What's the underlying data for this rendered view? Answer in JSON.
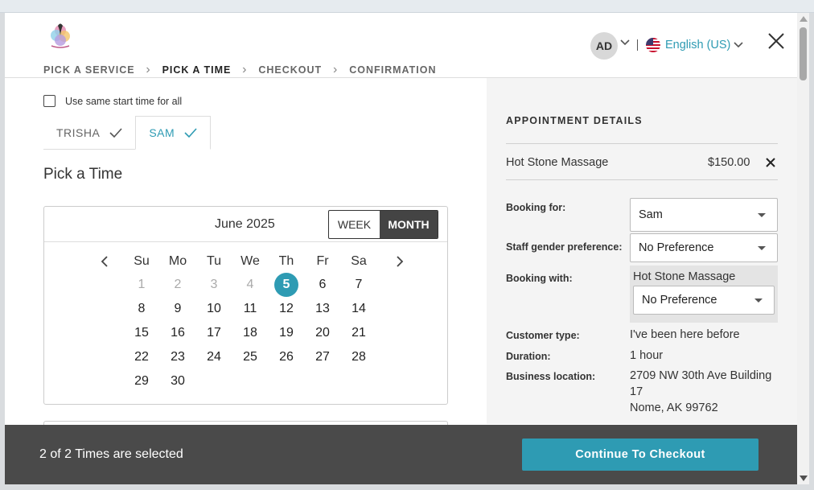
{
  "steps": [
    "PICK A SERVICE",
    "PICK A TIME",
    "CHECKOUT",
    "CONFIRMATION"
  ],
  "header": {
    "avatar_initials": "AD",
    "language": "English (US)"
  },
  "left": {
    "same_start_label": "Use same start time for all",
    "tabs": [
      "TRISHA",
      "SAM"
    ],
    "active_tab": "SAM",
    "pick_title": "Pick a Time"
  },
  "calendar": {
    "month_label": "June 2025",
    "view_week": "WEEK",
    "view_month": "MONTH",
    "weekdays": [
      "Su",
      "Mo",
      "Tu",
      "We",
      "Th",
      "Fr",
      "Sa"
    ],
    "weeks": [
      [
        "1",
        "2",
        "3",
        "4",
        "5",
        "6",
        "7"
      ],
      [
        "8",
        "9",
        "10",
        "11",
        "12",
        "13",
        "14"
      ],
      [
        "15",
        "16",
        "17",
        "18",
        "19",
        "20",
        "21"
      ],
      [
        "22",
        "23",
        "24",
        "25",
        "26",
        "27",
        "28"
      ],
      [
        "29",
        "30"
      ]
    ],
    "past_days": [
      "1",
      "2",
      "3",
      "4"
    ],
    "selected_day": "5"
  },
  "details": {
    "title": "APPOINTMENT DETAILS",
    "service_name": "Hot Stone Massage",
    "service_price": "$150.00",
    "booking_for_label": "Booking for:",
    "booking_for_value": "Sam",
    "gender_label": "Staff gender preference:",
    "gender_value": "No Preference",
    "booking_with_label": "Booking with:",
    "booking_with_service": "Hot Stone Massage",
    "booking_with_value": "No Preference",
    "customer_type_label": "Customer type:",
    "customer_type_value": "I've been here before",
    "duration_label": "Duration:",
    "duration_value": "1 hour",
    "location_label": "Business location:",
    "location_line1": "2709 NW 30th Ave Building",
    "location_line2": "17",
    "location_line3": "Nome, AK 99762"
  },
  "footer": {
    "status_text": "2 of 2 Times are selected",
    "cta_label": "Continue To Checkout"
  },
  "colors": {
    "accent": "#2e9bb3",
    "footer_bg": "#4a4a4a",
    "panel_bg": "#f4f4f4"
  }
}
